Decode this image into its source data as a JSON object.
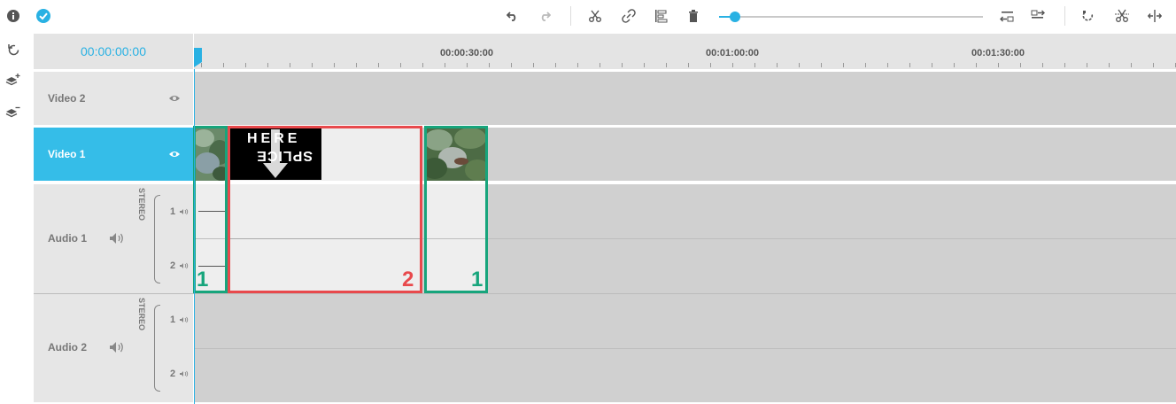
{
  "toolbar": {
    "info_icon": "info-circle-icon",
    "check_icon": "check-circle-icon",
    "zoom_level": 0.06
  },
  "header": {
    "timecode": "00:00:00:00"
  },
  "ruler": {
    "labels": [
      "00:00:30:00",
      "00:01:00:00",
      "00:01:30:00"
    ]
  },
  "tracks": {
    "video2": {
      "label": "Video 2"
    },
    "video1": {
      "label": "Video 1"
    },
    "audio1": {
      "label": "Audio 1",
      "stereo": "STEREO",
      "ch1": "1",
      "ch2": "2"
    },
    "audio2": {
      "label": "Audio 2",
      "stereo": "STEREO",
      "ch1": "1",
      "ch2": "2"
    }
  },
  "clips": {
    "splice_text_top": "HERE",
    "splice_text_bottom": "SPLICE"
  },
  "annotations": {
    "left_number": "1",
    "middle_number": "2",
    "right_number": "1"
  },
  "colors": {
    "accent": "#29b1e3",
    "green_frame": "#17a57c",
    "red_frame": "#e8494c"
  }
}
